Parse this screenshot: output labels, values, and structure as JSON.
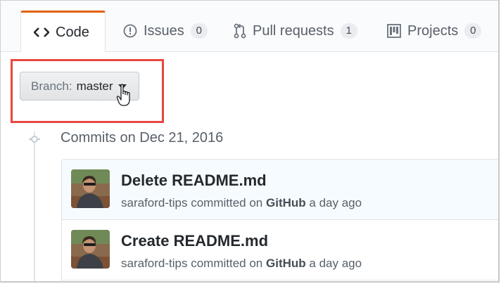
{
  "tabs": [
    {
      "label": "Code",
      "icon": "code-icon",
      "selected": true
    },
    {
      "label": "Issues",
      "icon": "issue-opened-icon",
      "count": "0"
    },
    {
      "label": "Pull requests",
      "icon": "git-pull-request-icon",
      "count": "1"
    },
    {
      "label": "Projects",
      "icon": "project-icon",
      "count": "0"
    }
  ],
  "branch": {
    "prefix": "Branch:",
    "name": "master"
  },
  "commits_group": {
    "title": "Commits on Dec 21, 2016"
  },
  "commits": [
    {
      "title": "Delete README.md",
      "author": "saraford-tips",
      "verb": "committed on",
      "platform": "GitHub",
      "time": "a day ago"
    },
    {
      "title": "Create README.md",
      "author": "saraford-tips",
      "verb": "committed on",
      "platform": "GitHub",
      "time": "a day ago"
    }
  ],
  "colors": {
    "highlight": "#e8473f",
    "selected_tab_accent": "#e36209"
  }
}
